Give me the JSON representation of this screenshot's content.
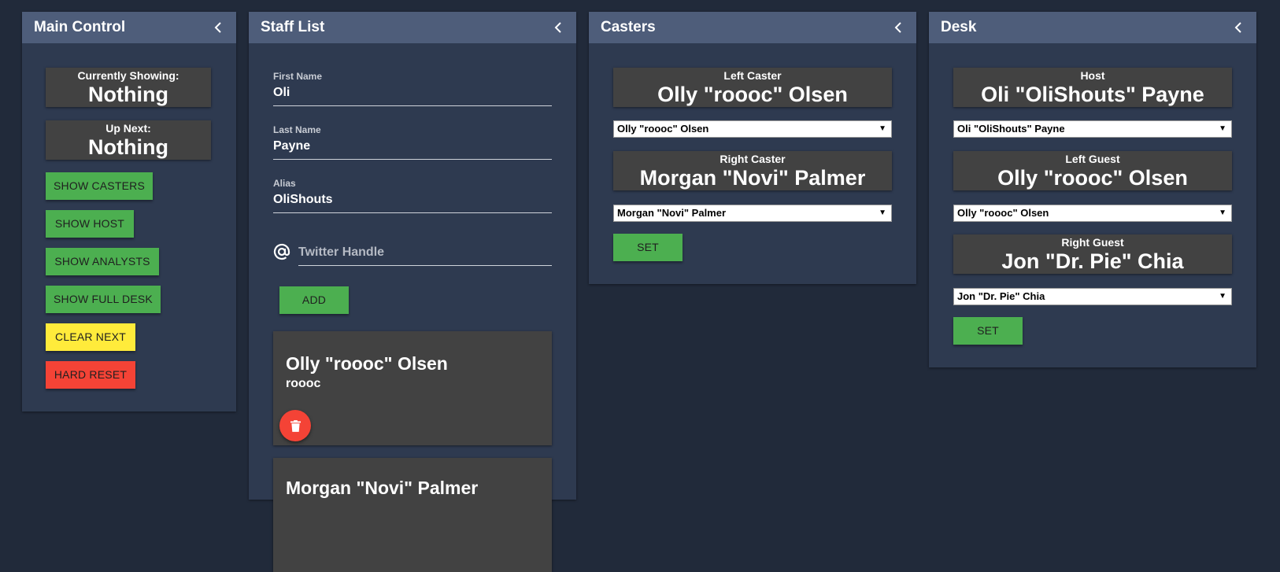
{
  "main_control": {
    "title": "Main Control",
    "currently_showing_label": "Currently Showing:",
    "currently_showing_value": "Nothing",
    "up_next_label": "Up Next:",
    "up_next_value": "Nothing",
    "buttons": {
      "show_casters": "SHOW CASTERS",
      "show_host": "SHOW HOST",
      "show_analysts": "SHOW ANALYSTS",
      "show_full_desk": "SHOW FULL DESK",
      "clear_next": "CLEAR NEXT",
      "hard_reset": "HARD RESET"
    }
  },
  "staff_list": {
    "title": "Staff List",
    "first_name_label": "First Name",
    "first_name_value": "Oli",
    "last_name_label": "Last Name",
    "last_name_value": "Payne",
    "alias_label": "Alias",
    "alias_value": "OliShouts",
    "twitter_placeholder": "Twitter Handle",
    "add_button": "ADD",
    "staff": [
      {
        "name": "Olly \"roooc\" Olsen",
        "alias": "roooc"
      },
      {
        "name": "Morgan \"Novi\" Palmer"
      }
    ]
  },
  "casters": {
    "title": "Casters",
    "left_label": "Left Caster",
    "left_value": "Olly \"roooc\" Olsen",
    "left_select": "Olly \"roooc\" Olsen",
    "right_label": "Right Caster",
    "right_value": "Morgan \"Novi\" Palmer",
    "right_select": "Morgan \"Novi\" Palmer",
    "set_button": "SET"
  },
  "desk": {
    "title": "Desk",
    "host_label": "Host",
    "host_value": "Oli \"OliShouts\" Payne",
    "host_select": "Oli \"OliShouts\" Payne",
    "left_guest_label": "Left Guest",
    "left_guest_value": "Olly \"roooc\" Olsen",
    "left_guest_select": "Olly \"roooc\" Olsen",
    "right_guest_label": "Right Guest",
    "right_guest_value": "Jon \"Dr. Pie\" Chia",
    "right_guest_select": "Jon \"Dr. Pie\" Chia",
    "set_button": "SET"
  },
  "colors": {
    "background": "#212a3a",
    "panel": "#2e3a50",
    "panel_header": "#4e5d7a",
    "display_box": "#424242",
    "green": "#4caf50",
    "yellow": "#ffeb3b",
    "red": "#f44336"
  },
  "icons": {
    "collapse": "chevron-left-icon",
    "twitter": "at-sign-icon",
    "delete": "trash-icon"
  }
}
